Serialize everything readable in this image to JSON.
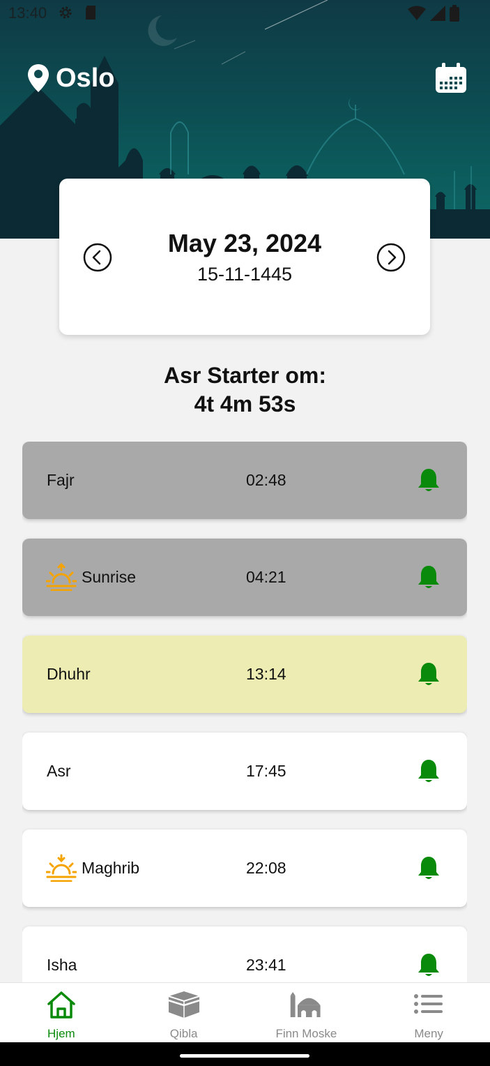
{
  "status_bar": {
    "time": "13:40"
  },
  "header": {
    "city": "Oslo"
  },
  "date_card": {
    "gregorian": "May 23, 2024",
    "hijri": "15-11-1445"
  },
  "countdown": {
    "line1": "Asr Starter om:",
    "line2": "4t 4m 53s"
  },
  "prayers": [
    {
      "name": "Fajr",
      "time": "02:48",
      "state": "past"
    },
    {
      "name": "Sunrise",
      "time": "04:21",
      "state": "past",
      "icon": "sunrise-icon"
    },
    {
      "name": "Dhuhr",
      "time": "13:14",
      "state": "current"
    },
    {
      "name": "Asr",
      "time": "17:45",
      "state": "upcoming"
    },
    {
      "name": "Maghrib",
      "time": "22:08",
      "state": "upcoming",
      "icon": "sunset-icon"
    },
    {
      "name": "Isha",
      "time": "23:41",
      "state": "upcoming"
    }
  ],
  "bottom_nav": [
    {
      "label": "Hjem",
      "icon": "home-icon",
      "active": true
    },
    {
      "label": "Qibla",
      "icon": "kaaba-icon",
      "active": false
    },
    {
      "label": "Finn Moske",
      "icon": "mosque-icon",
      "active": false
    },
    {
      "label": "Meny",
      "icon": "menu-list-icon",
      "active": false
    }
  ],
  "colors": {
    "header_dark": "#0f3a45",
    "header_light": "#0d6a66",
    "bell_green": "#0a8a0a",
    "past_row": "#a9a9a9",
    "current_row": "#ededb3",
    "sun_orange": "#f5a300"
  }
}
